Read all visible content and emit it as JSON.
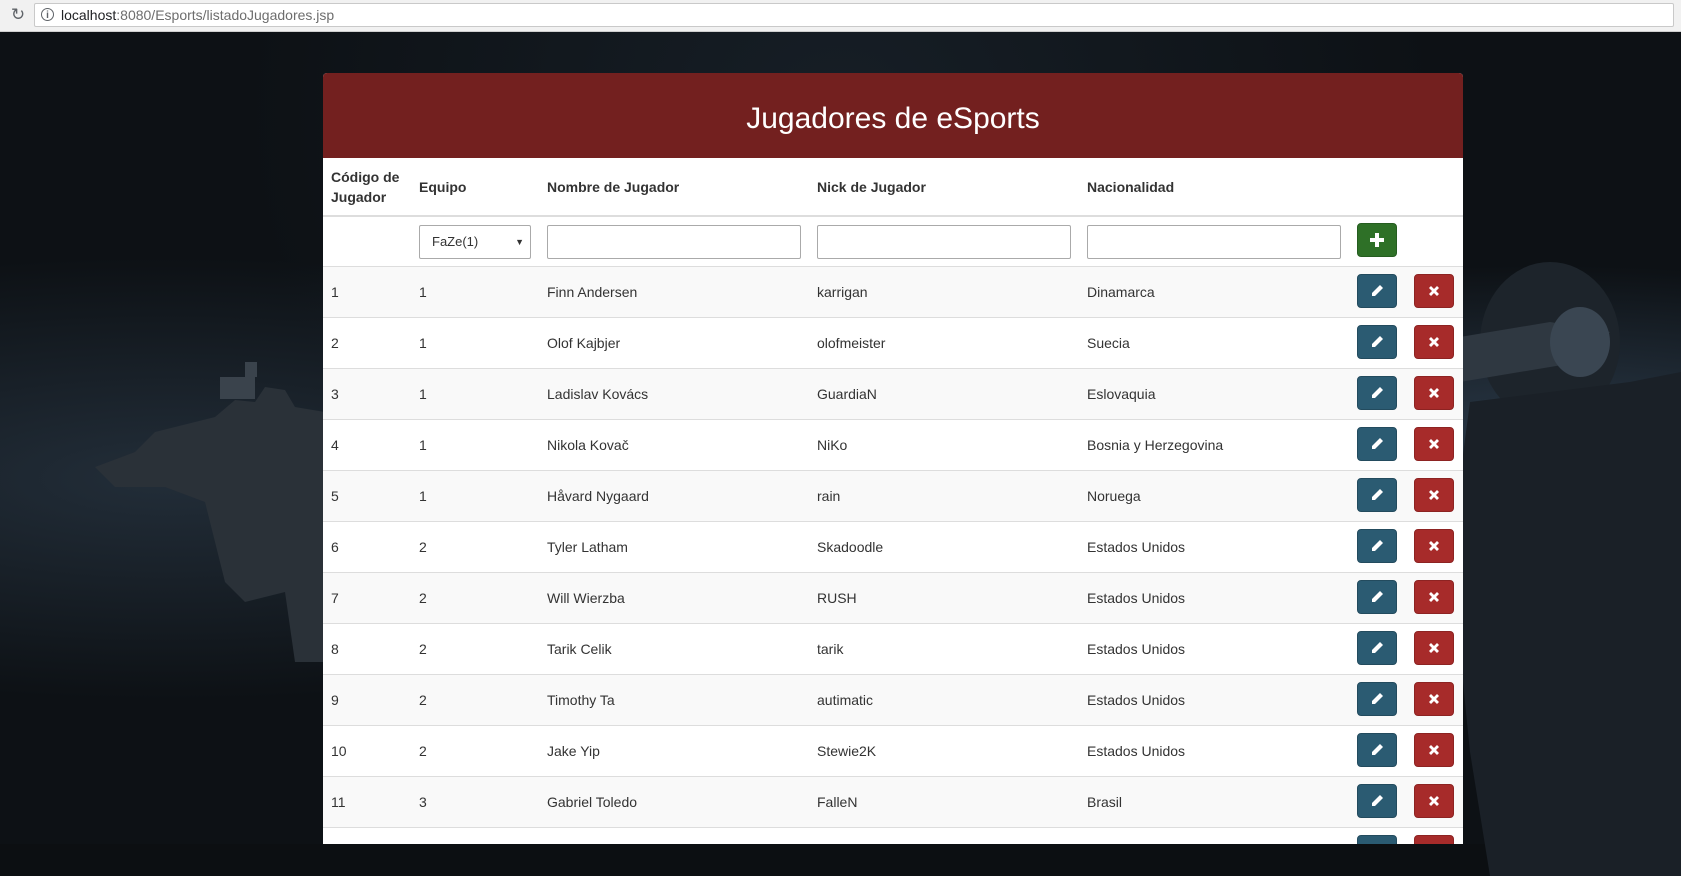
{
  "browser": {
    "url_host": "localhost",
    "url_rest": ":8080/Esports/listadoJugadores.jsp"
  },
  "page": {
    "title": "Jugadores de eSports"
  },
  "table": {
    "headers": {
      "codigo": "Código de Jugador",
      "equipo": "Equipo",
      "nombre": "Nombre de Jugador",
      "nick": "Nick de Jugador",
      "nacionalidad": "Nacionalidad"
    },
    "filter": {
      "equipo_selected": "FaZe(1)",
      "nombre_value": "",
      "nick_value": "",
      "nacionalidad_value": ""
    },
    "rows": [
      {
        "codigo": "1",
        "equipo": "1",
        "nombre": "Finn Andersen",
        "nick": "karrigan",
        "nacionalidad": "Dinamarca"
      },
      {
        "codigo": "2",
        "equipo": "1",
        "nombre": "Olof Kajbjer",
        "nick": "olofmeister",
        "nacionalidad": "Suecia"
      },
      {
        "codigo": "3",
        "equipo": "1",
        "nombre": "Ladislav Kovács",
        "nick": "GuardiaN",
        "nacionalidad": "Eslovaquia"
      },
      {
        "codigo": "4",
        "equipo": "1",
        "nombre": "Nikola Kovač",
        "nick": "NiKo",
        "nacionalidad": "Bosnia y Herzegovina"
      },
      {
        "codigo": "5",
        "equipo": "1",
        "nombre": "Håvard Nygaard",
        "nick": "rain",
        "nacionalidad": "Noruega"
      },
      {
        "codigo": "6",
        "equipo": "2",
        "nombre": "Tyler Latham",
        "nick": "Skadoodle",
        "nacionalidad": "Estados Unidos"
      },
      {
        "codigo": "7",
        "equipo": "2",
        "nombre": "Will Wierzba",
        "nick": "RUSH",
        "nacionalidad": "Estados Unidos"
      },
      {
        "codigo": "8",
        "equipo": "2",
        "nombre": "Tarik Celik",
        "nick": "tarik",
        "nacionalidad": "Estados Unidos"
      },
      {
        "codigo": "9",
        "equipo": "2",
        "nombre": "Timothy Ta",
        "nick": "autimatic",
        "nacionalidad": "Estados Unidos"
      },
      {
        "codigo": "10",
        "equipo": "2",
        "nombre": "Jake Yip",
        "nick": "Stewie2K",
        "nacionalidad": "Estados Unidos"
      },
      {
        "codigo": "11",
        "equipo": "3",
        "nombre": "Gabriel Toledo",
        "nick": "FalleN",
        "nacionalidad": "Brasil"
      },
      {
        "codigo": "",
        "equipo": "",
        "nombre": "",
        "nick": "",
        "nacionalidad": ""
      }
    ]
  },
  "icons": {
    "add": "plus-icon",
    "edit": "pencil-icon",
    "delete": "x-icon"
  },
  "colors": {
    "header_bg": "#73201f",
    "add_btn": "#2e7027",
    "edit_btn": "#2b5b72",
    "delete_btn": "#a72b2a"
  }
}
